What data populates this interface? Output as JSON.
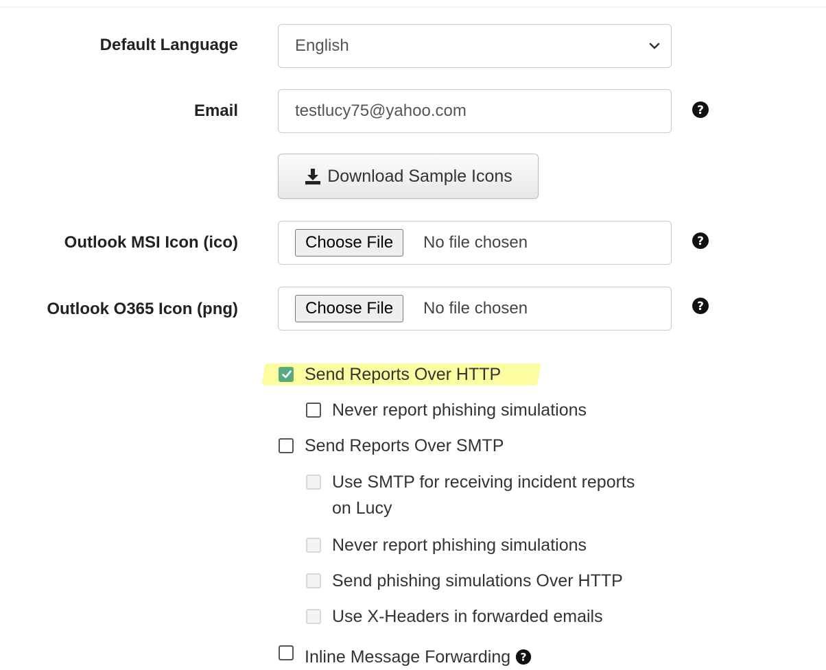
{
  "form": {
    "default_language": {
      "label": "Default Language",
      "selected": "English"
    },
    "email": {
      "label": "Email",
      "value": "testlucy75@yahoo.com"
    },
    "download_button": {
      "label": "Download Sample Icons",
      "icon": "download-icon"
    },
    "outlook_msi_icon": {
      "label": "Outlook MSI Icon (ico)",
      "button": "Choose File",
      "status": "No file chosen"
    },
    "outlook_o365_icon": {
      "label": "Outlook O365 Icon (png)",
      "button": "Choose File",
      "status": "No file chosen"
    },
    "options": [
      {
        "label": "Send Reports Over HTTP",
        "checked": true,
        "disabled": false,
        "highlighted": true
      },
      {
        "label": "Never report phishing simulations",
        "checked": false,
        "disabled": false
      },
      {
        "label": "Send Reports Over SMTP",
        "checked": false,
        "disabled": false
      },
      {
        "label": "Use SMTP for receiving incident reports",
        "label_line2": "on Lucy",
        "checked": false,
        "disabled": true
      },
      {
        "label": "Never report phishing simulations",
        "checked": false,
        "disabled": true
      },
      {
        "label": "Send phishing simulations Over HTTP",
        "checked": false,
        "disabled": true
      },
      {
        "label": "Use X-Headers in forwarded emails",
        "checked": false,
        "disabled": true
      },
      {
        "label": "Inline Message Forwarding",
        "checked": false,
        "disabled": false
      }
    ]
  },
  "colors": {
    "checked_accent": "#5ba97f",
    "highlight": "#fbfb8f"
  }
}
